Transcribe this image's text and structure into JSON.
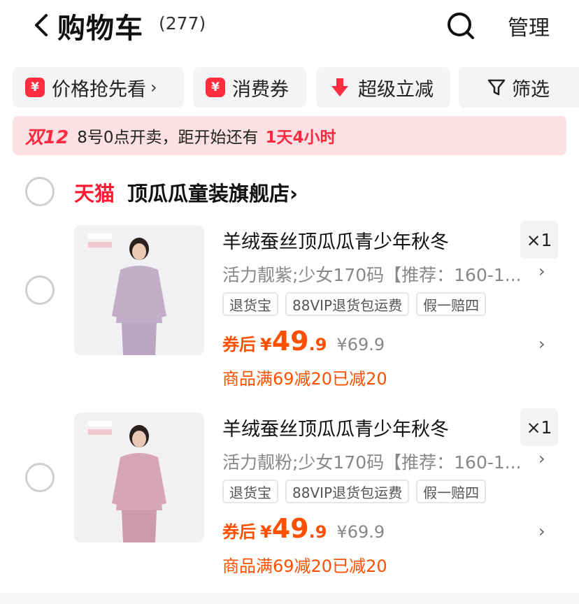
{
  "header": {
    "title": "购物车",
    "count": "(277)",
    "manage_label": "管理"
  },
  "filters": [
    {
      "icon": "¥",
      "label": "价格抢先看",
      "arrow": "›"
    },
    {
      "icon": "¥",
      "label": "消费券"
    },
    {
      "label": "超级立减"
    },
    {
      "label": "筛选"
    }
  ],
  "promo": {
    "logo": "双12",
    "text": "8号0点开卖，距开始还有",
    "time": "1天4小时"
  },
  "store": {
    "badge": "天猫",
    "name": "顶瓜瓜童装旗舰店",
    "arrow": "›"
  },
  "items": [
    {
      "name": "羊绒蚕丝顶瓜瓜青少年秋冬",
      "qty": "×1",
      "sku": "活力靓紫;少女170码【推荐：160-1...",
      "tags": [
        "退货宝",
        "88VIP退货包运费",
        "假一赔四"
      ],
      "price_prefix": "券后",
      "currency": "¥",
      "price_int": "49",
      "price_dec": ".9",
      "original_price": "¥69.9",
      "discount": "商品满69减20已减20",
      "color": "#c3aec8"
    },
    {
      "name": "羊绒蚕丝顶瓜瓜青少年秋冬",
      "qty": "×1",
      "sku": "活力靓粉;少女170码【推荐：160-1...",
      "tags": [
        "退货宝",
        "88VIP退货包运费",
        "假一赔四"
      ],
      "price_prefix": "券后",
      "currency": "¥",
      "price_int": "49",
      "price_dec": ".9",
      "original_price": "¥69.9",
      "discount": "商品满69减20已减20",
      "color": "#d7a6b6"
    }
  ],
  "colors": {
    "accent": "#ff5000",
    "tmall_red": "#ff1a33",
    "promo_bg": "#fbe1e4"
  }
}
